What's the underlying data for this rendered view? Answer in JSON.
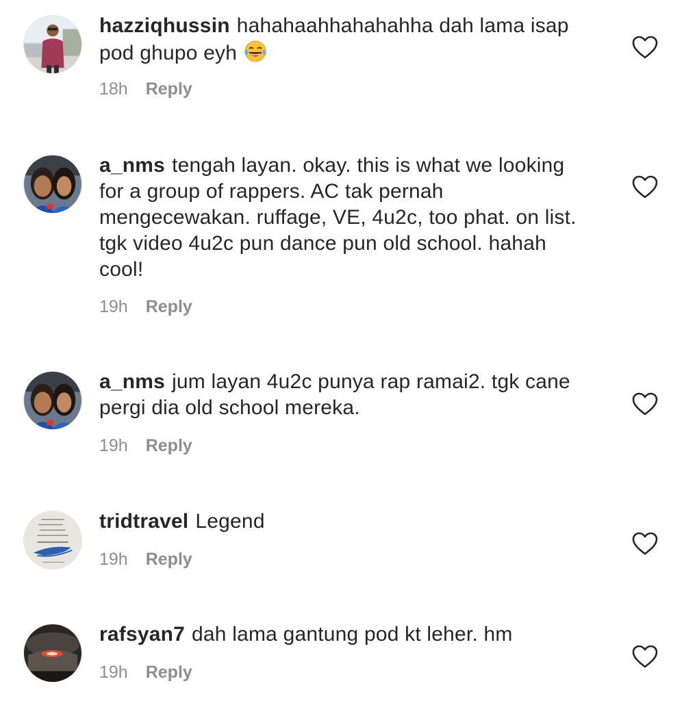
{
  "comments": [
    {
      "username": "hazziqhussin",
      "text": "hahahaahhahahahha dah lama isap pod ghupo eyh",
      "emoji": "face-with-tears-of-joy",
      "time": "18h",
      "reply_label": "Reply",
      "avatar_icon": "avatar-hazziqhussin"
    },
    {
      "username": "a_nms",
      "text": "tengah layan. okay. this is what we looking for a group of rappers. AC tak pernah mengecewakan. ruffage, VE, 4u2c, too phat. on list. tgk video 4u2c pun dance pun old school. hahah cool!",
      "time": "19h",
      "reply_label": "Reply",
      "avatar_icon": "avatar-a_nms"
    },
    {
      "username": "a_nms",
      "text": "jum layan 4u2c punya rap ramai2. tgk cane pergi dia old school mereka.",
      "time": "19h",
      "reply_label": "Reply",
      "avatar_icon": "avatar-a_nms"
    },
    {
      "username": "tridtravel",
      "text": "Legend",
      "time": "19h",
      "reply_label": "Reply",
      "avatar_icon": "avatar-tridtravel"
    },
    {
      "username": "rafsyan7",
      "text": "dah lama gantung pod kt leher. hm",
      "time": "19h",
      "reply_label": "Reply",
      "avatar_icon": "avatar-rafsyan7"
    }
  ],
  "colors": {
    "text": "#262626",
    "meta": "#8e8e8e",
    "background": "#ffffff"
  }
}
